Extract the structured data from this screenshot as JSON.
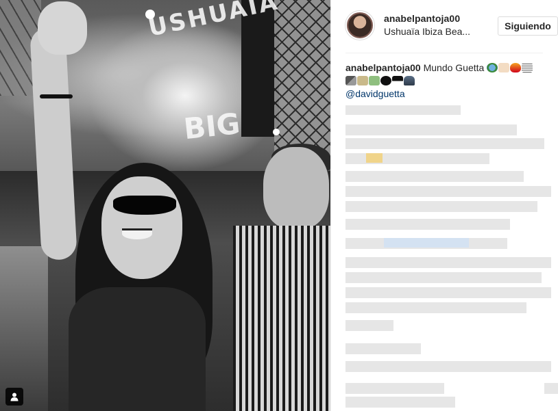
{
  "post": {
    "username": "anabelpantoja00",
    "location": "Ushuaïa Ibiza Bea...",
    "follow_label": "Siguiendo",
    "caption_text": "Mundo Guetta",
    "mention": "@davidguetta"
  },
  "photo": {
    "sign_top": "USHUAÏA",
    "sign_big": "BIG"
  },
  "icons": {
    "avatar": "avatar",
    "multi_user": "user-tag-icon",
    "emoji": [
      "globe-emoji",
      "raised-hands-emoji",
      "fire-emoji",
      "music-score-emoji",
      "microphone-emoji",
      "bottle-emoji",
      "money-emoji",
      "black-heart-emoji",
      "top-emoji",
      "car-emoji"
    ]
  },
  "colors": {
    "text": "#262626",
    "mention": "#003569",
    "border": "#dbdbdb",
    "blurred_text": "#e6e6e6",
    "blurred_highlight": "#f0d48a",
    "blurred_link": "#d4e2f2"
  }
}
